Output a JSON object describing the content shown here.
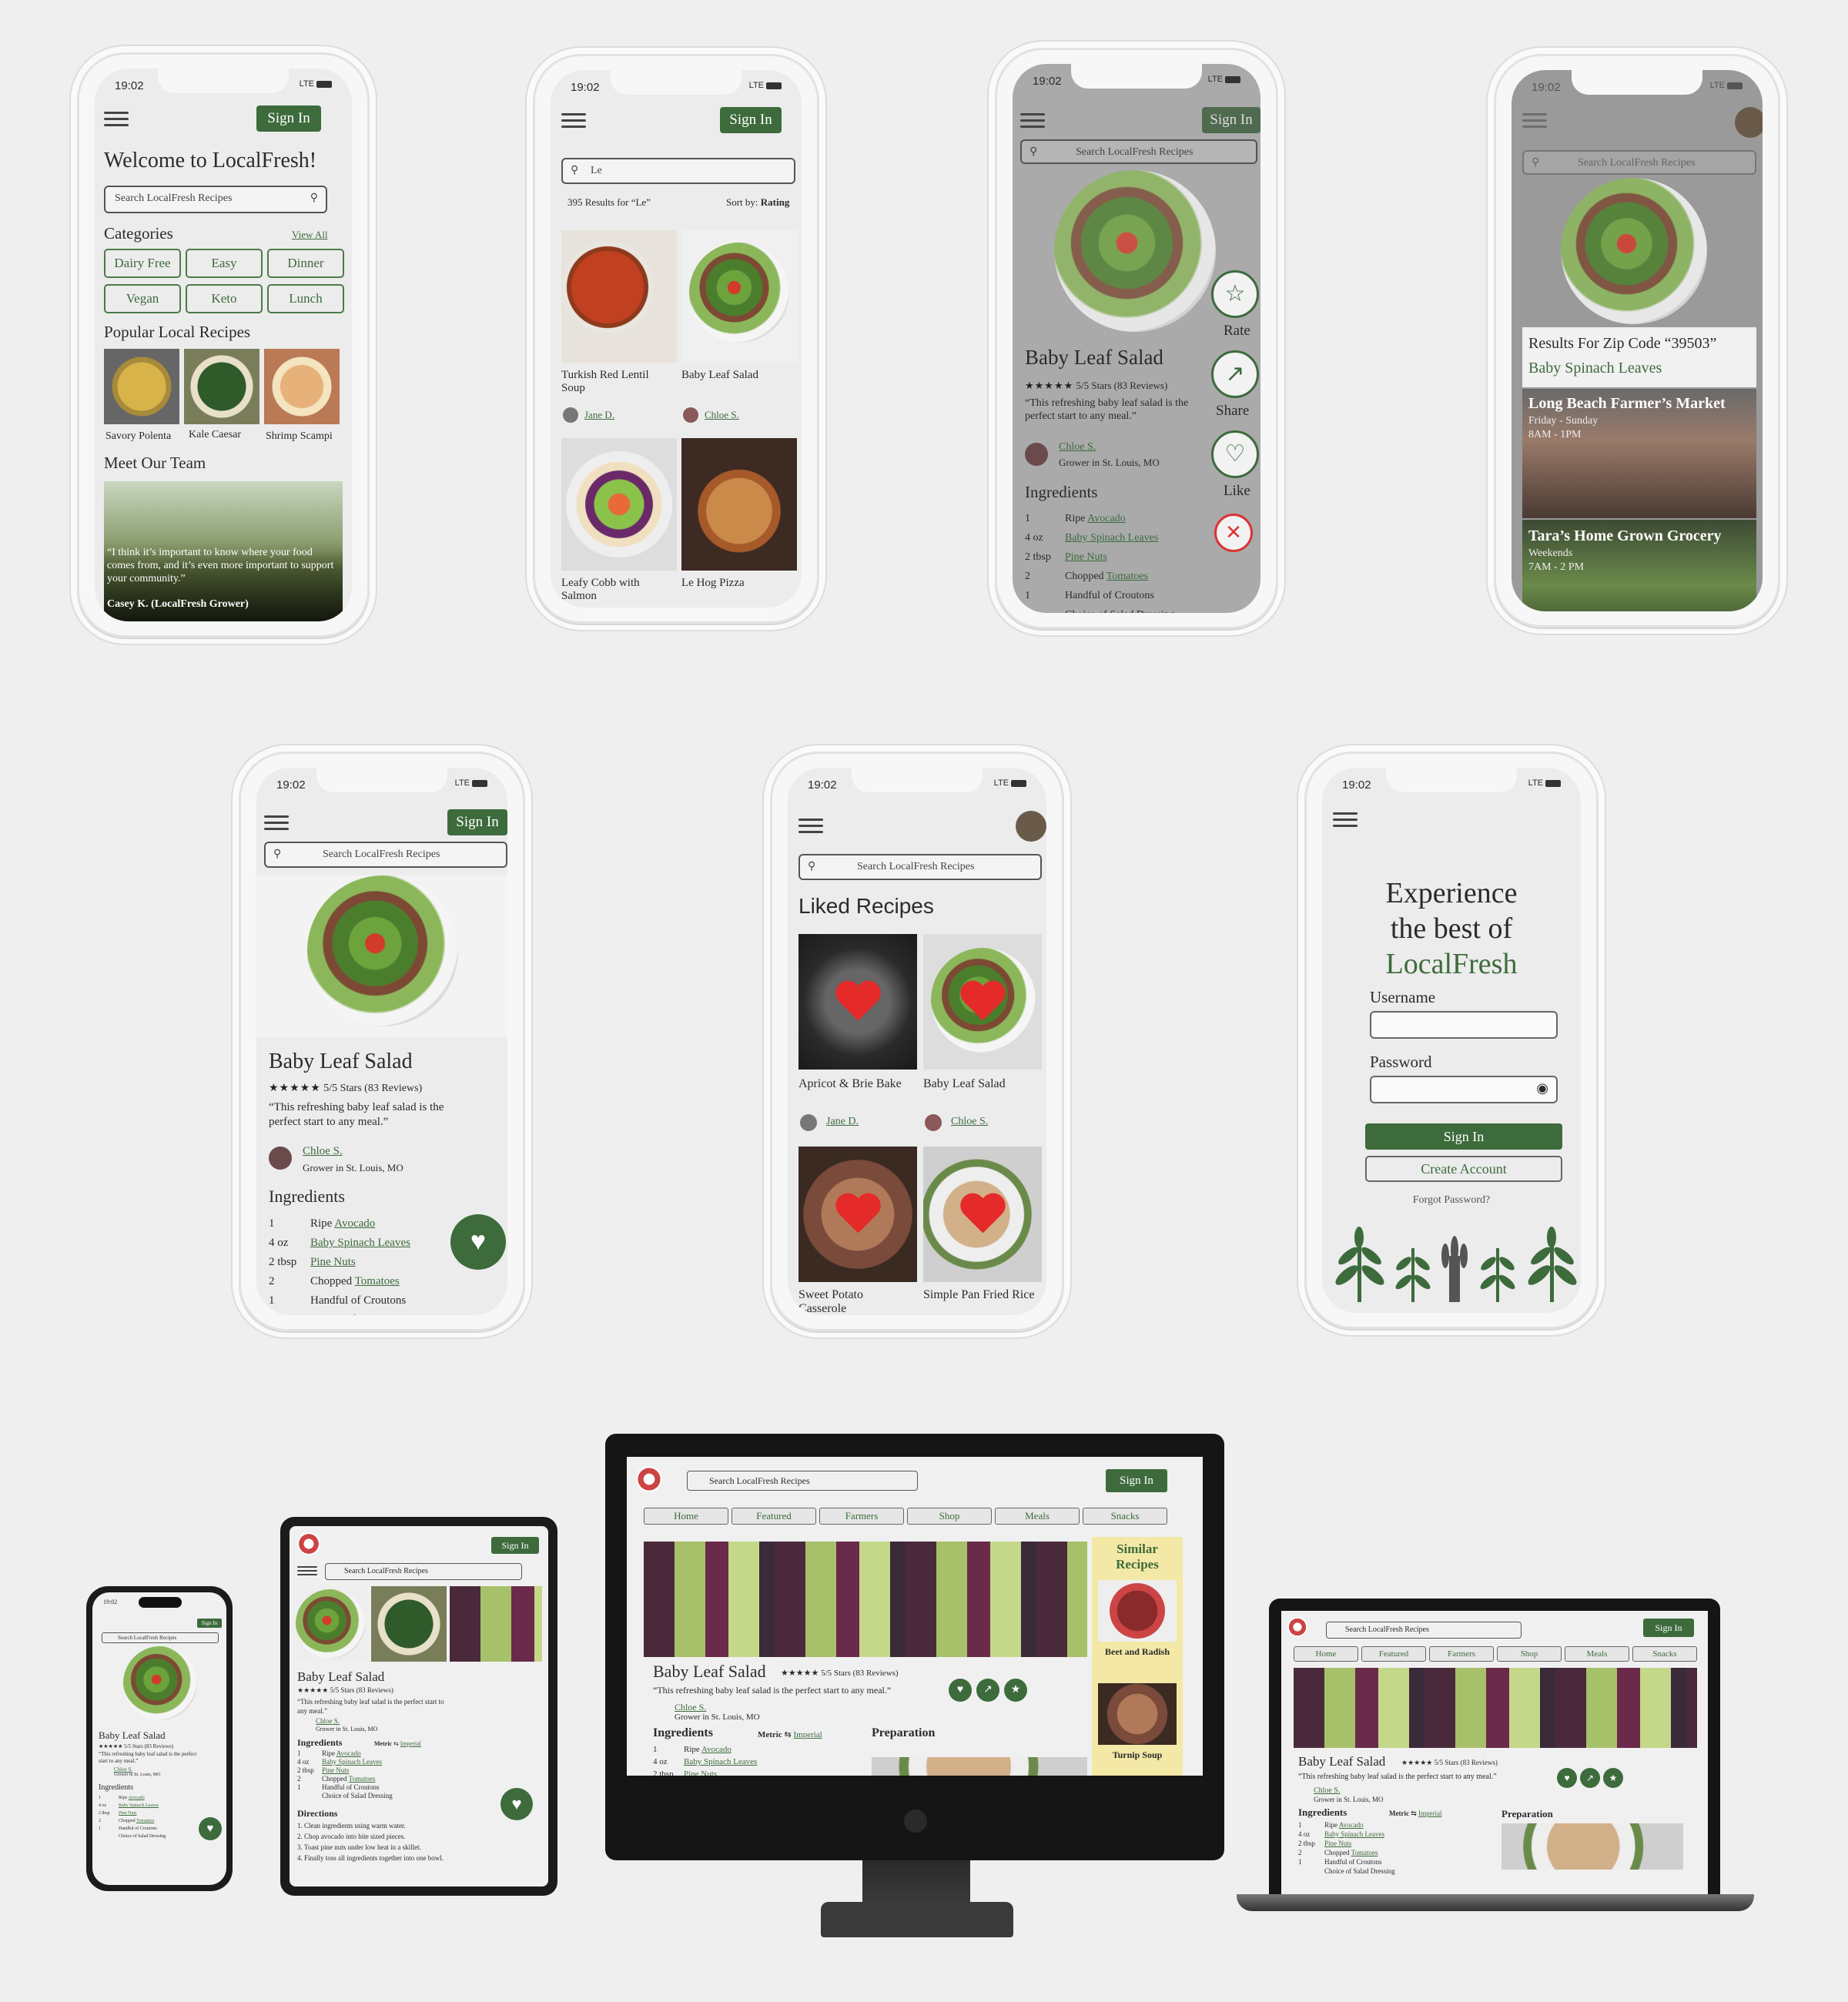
{
  "status": {
    "time": "19:02",
    "signal": "LTE"
  },
  "common": {
    "sign_in": "Sign In",
    "search_placeholder": "Search LocalFresh Recipes"
  },
  "screen1": {
    "welcome": "Welcome to LocalFresh!",
    "categories_title": "Categories",
    "view_all": "View All",
    "categories": [
      "Dairy Free",
      "Easy",
      "Dinner",
      "Vegan",
      "Keto",
      "Lunch"
    ],
    "popular_title": "Popular Local Recipes",
    "popular": [
      "Savory Polenta",
      "Kale Caesar",
      "Shrimp Scampi"
    ],
    "team_title": "Meet Our Team",
    "quote": "“I think it’s important to know where your food comes from, and it’s even more important to support your community.”",
    "quote_author": "Casey K. (LocalFresh Grower)"
  },
  "screen2": {
    "query": "Le",
    "results": "395 Results for “Le”",
    "sort_label": "Sort by:",
    "sort_value": "Rating",
    "items": [
      {
        "title": "Turkish Red Lentil Soup",
        "author": "Jane D."
      },
      {
        "title": "Baby Leaf Salad",
        "author": "Chloe S."
      },
      {
        "title": "Leafy Cobb with Salmon",
        "author": ""
      },
      {
        "title": "Le Hog Pizza",
        "author": ""
      }
    ]
  },
  "recipe": {
    "title": "Baby Leaf Salad",
    "rating": "5/5 Stars (83 Reviews)",
    "stars": "★★★★★",
    "quote": "“This refreshing baby leaf salad is the perfect start to any meal.”",
    "author": "Chloe S.",
    "author_sub": "Grower in St. Louis, MO",
    "ingredients_title": "Ingredients",
    "ingredients": [
      {
        "qty": "1",
        "pre": "Ripe ",
        "link": "Avocado"
      },
      {
        "qty": "4 oz",
        "pre": "",
        "link": "Baby Spinach Leaves"
      },
      {
        "qty": "2 tbsp",
        "pre": "",
        "link": "Pine Nuts"
      },
      {
        "qty": "2",
        "pre": "Chopped ",
        "link": "Tomatoes"
      },
      {
        "qty": "1",
        "pre": "Handful of Croutons",
        "link": ""
      },
      {
        "qty": "",
        "pre": "Choice of Salad Dressing",
        "link": ""
      }
    ],
    "actions": [
      "Rate",
      "Share",
      "Like"
    ]
  },
  "screen4": {
    "zip_title": "Results For Zip Code “39503”",
    "zip_item": "Baby Spinach Leaves",
    "markets": [
      {
        "name": "Long Beach Farmer’s Market",
        "days": "Friday - Sunday",
        "hours": "8AM - 1PM"
      },
      {
        "name": "Tara’s Home Grown Grocery",
        "days": "Weekends",
        "hours": "7AM - 2 PM"
      }
    ]
  },
  "screen6": {
    "title": "Liked Recipes",
    "items": [
      {
        "title": "Apricot & Brie Bake",
        "author": "Jane D."
      },
      {
        "title": "Baby Leaf Salad",
        "author": "Chloe S."
      },
      {
        "title": "Sweet Potato Casserole",
        "author": ""
      },
      {
        "title": "Simple Pan Fried Rice",
        "author": ""
      }
    ]
  },
  "screen7": {
    "headline1": "Experience",
    "headline2": "the best of",
    "headline3": "LocalFresh",
    "username_label": "Username",
    "password_label": "Password",
    "sign_in": "Sign In",
    "create": "Create Account",
    "forgot": "Forgot Password?"
  },
  "desktop": {
    "tabs": [
      "Home",
      "Featured",
      "Farmers",
      "Shop",
      "Meals",
      "Snacks"
    ],
    "similar_title": "Similar Recipes",
    "similar": [
      "Beet and Radish",
      "Turnip Soup"
    ],
    "units": "Metric ⇆ Imperial",
    "metric": "Metric",
    "imperial": "Imperial",
    "preparation": "Preparation",
    "directions_title": "Directions",
    "directions": [
      "1. Clean ingredients using warm water.",
      "2. Chop avocado into bite sized pieces.",
      "3. Toast pine nuts under low heat in a skillet.",
      "4. Finally toss all ingredients together into one bowl."
    ]
  },
  "colors": {
    "brand_green": "#3d6b3c",
    "heart_red": "#e52a2a",
    "similar_bg": "#f4e8a6"
  }
}
